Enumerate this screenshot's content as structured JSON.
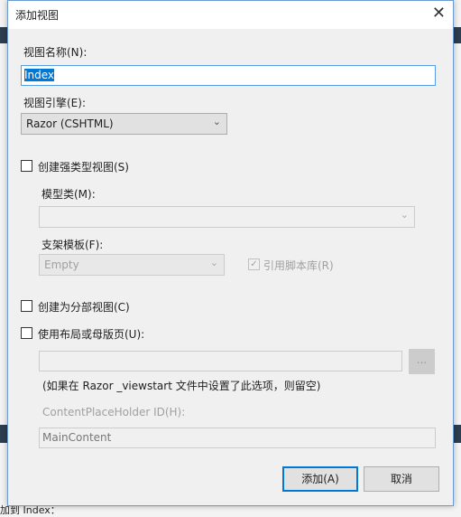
{
  "dialog": {
    "title": "添加视图",
    "view_name_label": "视图名称(N):",
    "view_name_value": "Index",
    "view_engine_label": "视图引擎(E):",
    "view_engine_value": "Razor (CSHTML)",
    "strong_type_label": "创建强类型视图(S)",
    "model_class_label": "模型类(M):",
    "model_class_value": "",
    "scaffold_label": "支架模板(F):",
    "scaffold_value": "Empty",
    "script_lib_label": "引用脚本库(R)",
    "partial_view_label": "创建为分部视图(C)",
    "layout_label": "使用布局或母版页(U):",
    "layout_value": "",
    "browse_label": "...",
    "layout_hint": "(如果在 Razor _viewstart 文件中设置了此选项，则留空)",
    "placeholder_label": "ContentPlaceHolder ID(H):",
    "placeholder_value": "MainContent",
    "add_button": "添加(A)",
    "cancel_button": "取消"
  },
  "background": {
    "bottom_text": "加到 Index："
  }
}
